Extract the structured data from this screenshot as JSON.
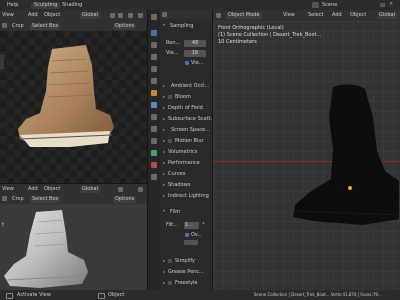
{
  "topbar": {
    "help": "Help",
    "tabs": [
      "Sculpting",
      "Shading"
    ],
    "scene": "Scene"
  },
  "left_top_header": {
    "view": "View",
    "add": "Add",
    "object": "Object",
    "global": "Global",
    "crop": "Crop",
    "select_box": "Select Box",
    "options": "Options"
  },
  "left_bottom_header": {
    "view": "View",
    "add": "Add",
    "object": "Object",
    "global": "Global",
    "crop": "Crop",
    "select_box": "Select Box",
    "options": "Options"
  },
  "properties": {
    "header": "Sampling",
    "render_label": "Ren...",
    "render_value": "48",
    "viewport_label": "Vie...",
    "viewport_value": "16",
    "denoise_label": "Vie...",
    "sections": [
      "Ambient Occl...",
      "Bloom",
      "Depth of Field",
      "Subsurface Scatt...",
      "Screen Space...",
      "Motion Blur",
      "Volumetrics",
      "Performance",
      "Curves",
      "Shadows",
      "Indirect Lighting",
      "Film",
      "Simplify",
      "Grease Penc...",
      "Freestyle"
    ],
    "film_filter_label": "Filt...",
    "film_filter_value": "1...",
    "film_overscan_label": "Ov..."
  },
  "viewport": {
    "header_mode": "Object Mode",
    "view": "View",
    "select": "Select",
    "add": "Add",
    "object": "Object",
    "global": "Global",
    "overlay_line1": "Front Orthographic (Local)",
    "overlay_line2": "(1) Scene Collection | Desert_Trek_Boot...",
    "overlay_line3": "10 Centimeters"
  },
  "statusbar": {
    "left": "Activate View",
    "mid": "Object",
    "right": "Scene Collection | Desert_Trek_Boot...   Verts:41,874 | Faces:79..."
  },
  "colors": {
    "accent": "#4772b3",
    "boot_tan": "#b8926a",
    "origin": "#f0a030",
    "x_axis": "#8a2a2a"
  }
}
